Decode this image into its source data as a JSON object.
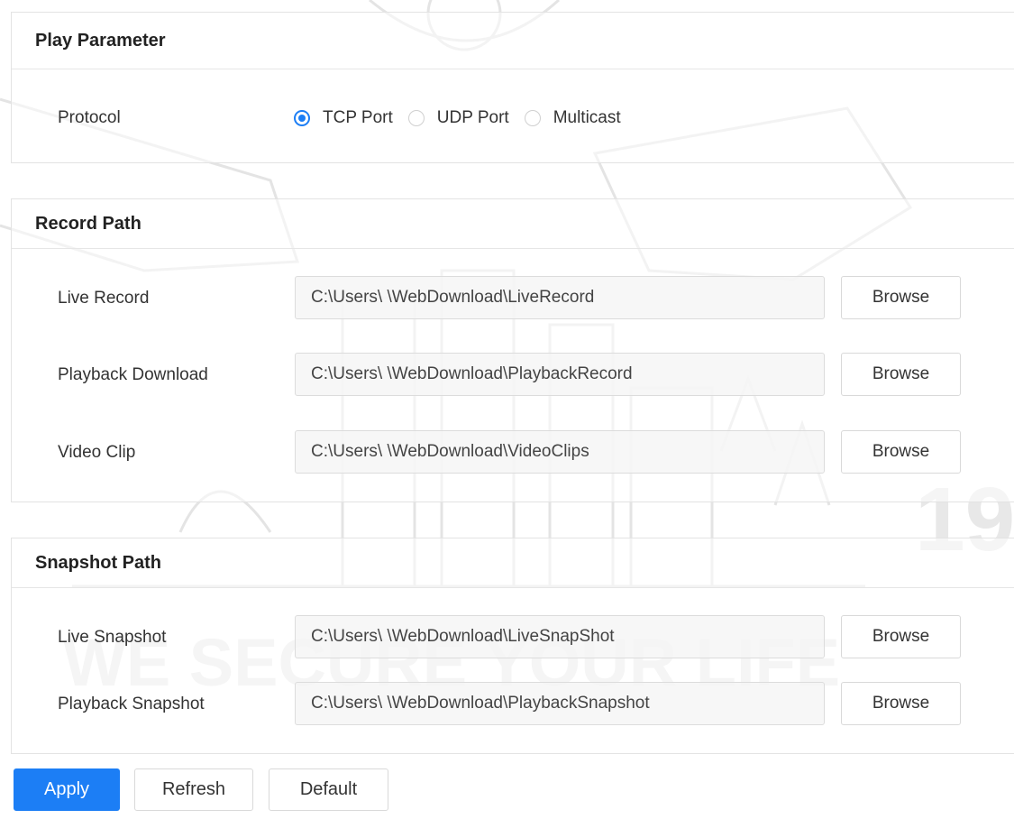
{
  "play_parameter": {
    "title": "Play Parameter",
    "protocol_label": "Protocol",
    "options": [
      {
        "label": "TCP Port",
        "checked": true
      },
      {
        "label": "UDP Port",
        "checked": false
      },
      {
        "label": "Multicast",
        "checked": false
      }
    ]
  },
  "record_path": {
    "title": "Record Path",
    "rows": [
      {
        "label": "Live Record",
        "value": "C:\\Users\\    \\WebDownload\\LiveRecord",
        "browse": "Browse"
      },
      {
        "label": "Playback Download",
        "value": "C:\\Users\\    \\WebDownload\\PlaybackRecord",
        "browse": "Browse"
      },
      {
        "label": "Video Clip",
        "value": "C:\\Users\\    \\WebDownload\\VideoClips",
        "browse": "Browse"
      }
    ]
  },
  "snapshot_path": {
    "title": "Snapshot Path",
    "rows": [
      {
        "label": "Live Snapshot",
        "value": "C:\\Users\\    \\WebDownload\\LiveSnapShot",
        "browse": "Browse"
      },
      {
        "label": "Playback Snapshot",
        "value": "C:\\Users\\    \\WebDownload\\PlaybackSnapshot",
        "browse": "Browse"
      }
    ]
  },
  "actions": {
    "apply": "Apply",
    "refresh": "Refresh",
    "default": "Default"
  },
  "watermark": {
    "slogan": "WE SECURE YOUR LIFE",
    "year_fragment": "19"
  },
  "colors": {
    "accent": "#1c7ef5",
    "border": "#e3e3e3",
    "watermark": "#cfcfcf"
  }
}
